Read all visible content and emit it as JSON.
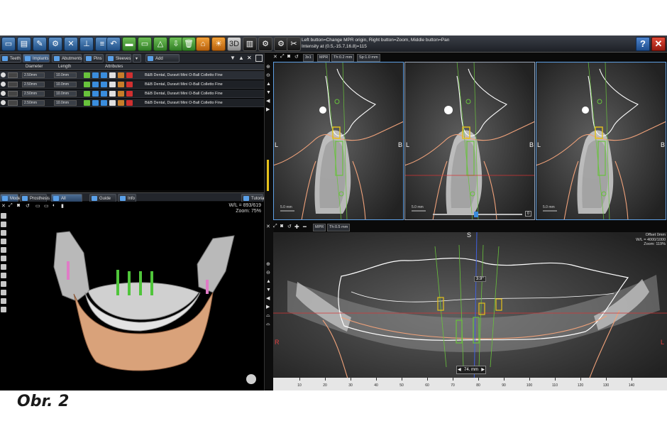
{
  "toolbar": {
    "hint_line1": "Left button=Change MPR origin, Right button=Zoom, Middle button=Pan",
    "hint_line2": "Intensity at (0.5,-15.7,16.8)=115",
    "btn_3d": "3D",
    "help": "?",
    "close": "✕"
  },
  "top_tabs": [
    "Teeth",
    "Implants",
    "Abutments",
    "Pins",
    "Sleeves",
    "Add Implant"
  ],
  "table": {
    "headers": [
      "Diameter",
      "Length",
      "Attributes"
    ],
    "rows": [
      {
        "diameter": "2.50mm",
        "length": "10.0mm",
        "name": "B&B Dental, Duravit Mini O-Ball Colletto Fine"
      },
      {
        "diameter": "2.50mm",
        "length": "10.0mm",
        "name": "B&B Dental, Duravit Mini O-Ball Colletto Fine"
      },
      {
        "diameter": "2.50mm",
        "length": "10.0mm",
        "name": "B&B Dental, Duravit Mini O-Ball Colletto Fine"
      },
      {
        "diameter": "2.50mm",
        "length": "10.0mm",
        "name": "B&B Dental, Duravit Mini O-Ball Colletto Fine"
      }
    ]
  },
  "mid_tabs": [
    "Model",
    "Prosthesis",
    "All Objects",
    "Guide Tools",
    "Info",
    "Tutorial"
  ],
  "view3d": {
    "wl": "W/L = 893/619",
    "zoom": "Zoom: 75%"
  },
  "mpr_bar": [
    "3x1",
    "MPR",
    "Th:0.2 mm",
    "Sp:1.0 mm"
  ],
  "axial_bar": [
    "MPR",
    "Th:0.5 mm"
  ],
  "cross": {
    "left_label": "L",
    "right_label": "B",
    "scale": "5.0 mm",
    "slider_value": "0"
  },
  "axial": {
    "top_label": "S",
    "left_label": "R",
    "right_label": "L",
    "angle": "3.9°",
    "offset": "Offset 0mm",
    "wl": "W/L = 4000/1000",
    "zoom": "Zoom: 119%",
    "measure": "74. mm",
    "ruler": [
      "10",
      "20",
      "30",
      "40",
      "50",
      "60",
      "70",
      "80",
      "90",
      "100",
      "110",
      "120",
      "130",
      "140"
    ]
  },
  "caption": "Obr. 2",
  "colors": {
    "accent_blue": "#5fa0e4",
    "nerve_orange": "#f0a27a",
    "implant_green": "#68c23c",
    "implant_yellow": "#e6c21a",
    "crosshair_red": "#d43434",
    "model_bone": "#d9a27a"
  }
}
